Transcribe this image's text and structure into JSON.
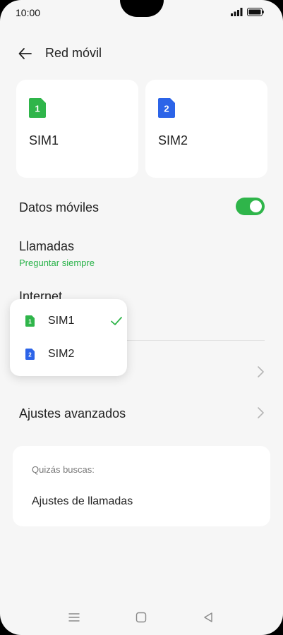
{
  "status_bar": {
    "time": "10:00"
  },
  "header": {
    "title": "Red móvil"
  },
  "sim_cards": [
    {
      "label": "SIM1",
      "badge_number": "1",
      "color": "#2fb54a"
    },
    {
      "label": "SIM2",
      "badge_number": "2",
      "color": "#2c64e8"
    }
  ],
  "settings": {
    "mobile_data": {
      "label": "Datos móviles",
      "enabled": true
    },
    "calls": {
      "label": "Llamadas",
      "value": "Preguntar siempre"
    },
    "internet": {
      "label": "Internet"
    },
    "advanced": {
      "label": "Ajustes avanzados"
    }
  },
  "popup": {
    "items": [
      {
        "label": "SIM1",
        "badge_number": "1",
        "color": "#2fb54a",
        "selected": true
      },
      {
        "label": "SIM2",
        "badge_number": "2",
        "color": "#2c64e8",
        "selected": false
      }
    ]
  },
  "suggestions": {
    "title": "Quizás buscas:",
    "items": [
      {
        "label": "Ajustes de llamadas"
      }
    ]
  },
  "colors": {
    "accent": "#2fb54a",
    "sim2": "#2c64e8",
    "background": "#f6f6f6"
  },
  "nav_icons": [
    "menu-icon",
    "home-icon",
    "back-triangle-icon"
  ]
}
